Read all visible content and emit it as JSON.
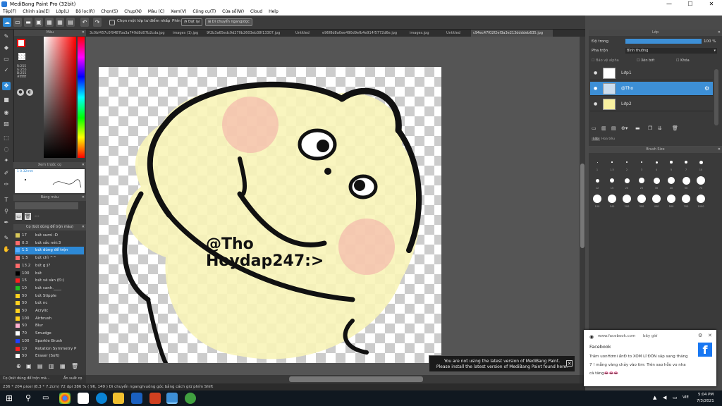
{
  "window": {
    "title": "MediBang Paint Pro (32bit)",
    "min": "—",
    "max": "☐",
    "close": "✕"
  },
  "menu": [
    "Tệp(F)",
    "Chỉnh sửa(E)",
    "Lớp(L)",
    "Bộ lọc(R)",
    "Chọn(S)",
    "Chụp(N)",
    "Màu (C)",
    "Xem(V)",
    "Công cụ(T)",
    "Cửa sổ(W)",
    "Cloud",
    "Help"
  ],
  "toolbar": {
    "snap_label": "Chọn một lớp tư điểm nhấp",
    "phin_label": "Phín",
    "off_label": "Đặt lại",
    "move_label": "Di chuyển ngang/dọc"
  },
  "tabs": [
    "3c0bf457c0f9487ba3a749d8d07b2cda.jpg",
    "images (1).jpg",
    "9f2b3a65edc9d270b2603eb38f13307.jpg",
    "Untitled",
    "e96f8d8a0ee490d9efb4e914f5772d6e.jpg",
    "images.jpg",
    "Untitled",
    "c94ec47f02f2ef3a3e213ddddeb635.jpg"
  ],
  "color_panel": {
    "title": "Màu",
    "r": "R:255",
    "g": "G:255",
    "b": "B:255",
    "hex": "#ffffff"
  },
  "brush_preview": {
    "title": "Xem trước cọ",
    "size": "1 0.32mm"
  },
  "palette": {
    "title": "Bảng màu",
    "value": "---"
  },
  "brushes": {
    "title": "Cọ (bút dùng để trộn màu)",
    "items": [
      {
        "size": "17",
        "name": "bút sumi :D",
        "color": "#d8c85a"
      },
      {
        "size": "0.3",
        "name": "bút sắc nét:3",
        "color": "#ff6b6b"
      },
      {
        "size": "1.1",
        "name": "bút dùng để trộn",
        "color": "#5ab0ff"
      },
      {
        "size": "1.5",
        "name": "bút chì ^^",
        "color": "#ff6b6b"
      },
      {
        "size": "13.2",
        "name": "bút g:)?",
        "color": "#ff6b6b"
      },
      {
        "size": "100",
        "name": "bút",
        "color": "#000000"
      },
      {
        "size": "15",
        "name": "bút vẽ sàn (Đ:)",
        "color": "#ff2020"
      },
      {
        "size": "10",
        "name": "bút canh.____",
        "color": "#20c020"
      },
      {
        "size": "50",
        "name": "bút Stipple",
        "color": "#ffd020"
      },
      {
        "size": "50",
        "name": "bút nc",
        "color": "#ffd020"
      },
      {
        "size": "50",
        "name": "Acrylic",
        "color": "#ffd020"
      },
      {
        "size": "100",
        "name": "Airbrush",
        "color": "#ffd020"
      },
      {
        "size": "50",
        "name": "Blur",
        "color": "#ffb0d0"
      },
      {
        "size": "70",
        "name": "Smudge",
        "color": "#ffffff"
      },
      {
        "size": "100",
        "name": "Sparkle Brush",
        "color": "#2040ff"
      },
      {
        "size": "10",
        "name": "Rotation Symmetry P",
        "color": "#ff2020"
      },
      {
        "size": "50",
        "name": "Eraser (Soft)",
        "color": "#ffffff"
      }
    ]
  },
  "bottom_tabs": [
    "Cọ (bút dùng để trộn mà...",
    "Ấn suất cọ"
  ],
  "status": "236 * 204 pixel  (8.3 * 7.2cm)  72 dpi  386 %  ( 96, 149 )  Di chuyển ngang/vuông góc bằng cách giữ phím Shift",
  "layer_panel": {
    "title": "Lớp",
    "opacity_label": "Độ trong",
    "opacity_value": "100 %",
    "blend_label": "Pha trộn",
    "blend_value": "Bình thường",
    "protect": "Bảo vệ alpha",
    "clip": "Xén bớt",
    "lock": "Khóa",
    "layers": [
      "Lớp1",
      "@Tho",
      "Lớp2"
    ],
    "footer_tabs": [
      "Lớp",
      "Hoa tiêu"
    ]
  },
  "brush_size": {
    "title": "Brush Size",
    "row1": [
      "1",
      "1.5",
      "2",
      "3",
      "4",
      "5",
      "7",
      "10"
    ],
    "row2": [
      "12",
      "15",
      "20",
      "25",
      "30",
      "40",
      "50",
      "70"
    ],
    "row3": [
      "100",
      "140",
      "200",
      "300",
      "400",
      "500",
      "700",
      "1000"
    ]
  },
  "canvas_text": {
    "line1": "@Tho",
    "line2": "Hoydap247:>"
  },
  "update_msg": {
    "line1": "You are not using the latest version of MediBang Paint.",
    "line2": "Please install the latest version of MediBang Paint found here."
  },
  "notification": {
    "source": "www.facebook.com",
    "time": "bây giờ",
    "app": "Facebook",
    "body": "Trầm uonHơmi ẩnĐ to XÓM LÍ ĐÔN sắp sang tháng 7 ! mẫng vàng chảy vào tim: Trên sao hỗo vo nha cả tăng👄👄👄"
  },
  "taskbar": {
    "lang": "VIE",
    "time": "5:04 PM",
    "date": "7/3/2021"
  }
}
